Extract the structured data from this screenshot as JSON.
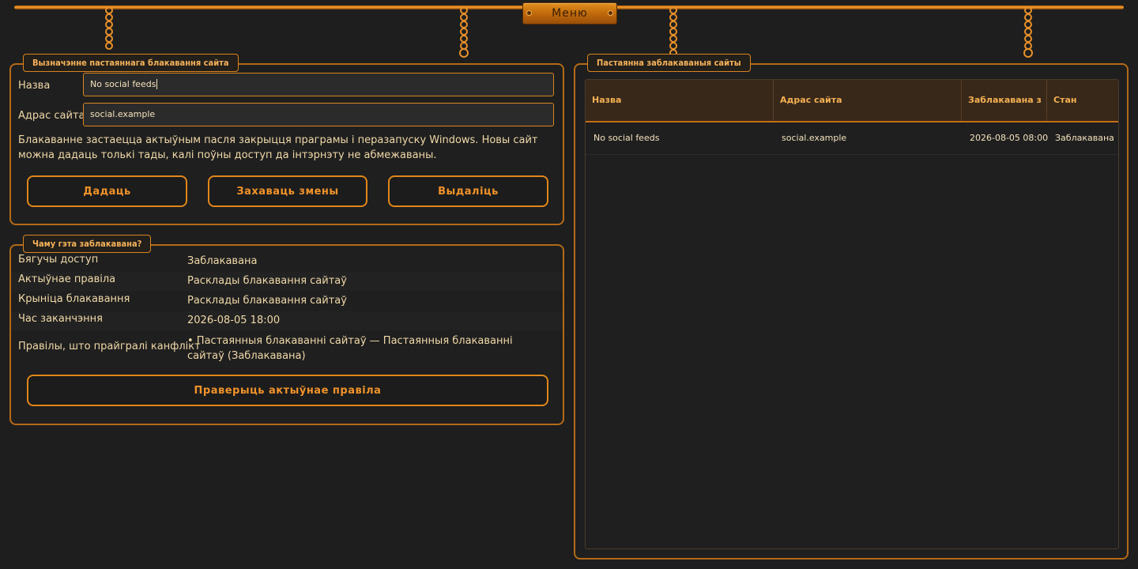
{
  "menu": {
    "label": "Меню"
  },
  "rule_panel": {
    "title": "Вызначэнне пастаяннага блакавання сайта",
    "name_label": "Назва",
    "name_value": "No social feeds",
    "address_label": "Адрас сайта",
    "address_value": "social.example",
    "info": "Блакаванне застаецца актыўным пасля закрыцця праграмы і перазапуску Windows. Новы сайт можна дадаць толькі тады, калі поўны доступ да інтэрнэту не абмежаваны.",
    "buttons": {
      "add": "Дадаць",
      "save": "Захаваць змены",
      "delete": "Выдаліць"
    }
  },
  "why_panel": {
    "title": "Чаму гэта заблакавана?",
    "rows": [
      {
        "key": "Бягучы доступ",
        "value": "Заблакавана"
      },
      {
        "key": "Актыўнае правіла",
        "value": "Расклады блакавання сайтаў"
      },
      {
        "key": "Крыніца блакавання",
        "value": "Расклады блакавання сайтаў"
      },
      {
        "key": "Час заканчэння",
        "value": "2026-08-05 18:00"
      },
      {
        "key": "Правілы, што прайгралі канфлікт",
        "value": "• Пастаянныя блакаванні сайтаў — Пастаянныя блакаванні сайтаў (Заблакавана)"
      }
    ],
    "check_button": "Праверыць актыўнае правіла"
  },
  "blocked_panel": {
    "title": "Пастаянна заблакаваныя сайты",
    "columns": [
      "Назва",
      "Адрас сайта",
      "Заблакавана з",
      "Стан"
    ],
    "rows": [
      [
        "No social feeds",
        "social.example",
        "2026-08-05 08:00",
        "Заблакавана"
      ]
    ]
  }
}
